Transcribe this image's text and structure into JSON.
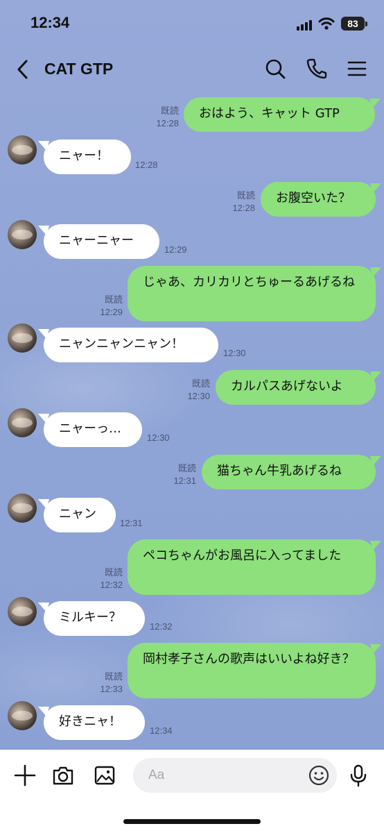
{
  "status": {
    "time": "12:34",
    "battery": "83"
  },
  "header": {
    "back_icon": "chevron-left",
    "title": "CAT GTP",
    "search_icon": "search",
    "call_icon": "phone",
    "menu_icon": "menu"
  },
  "messages": [
    {
      "side": "out",
      "read": "既読",
      "time": "12:28",
      "text": "おはよう、キャット GTP"
    },
    {
      "side": "in",
      "time": "12:28",
      "text": "ニャー！"
    },
    {
      "side": "out",
      "read": "既読",
      "time": "12:28",
      "text": "お腹空いた？"
    },
    {
      "side": "in",
      "time": "12:29",
      "text": "ニャーニャー"
    },
    {
      "side": "out",
      "read": "既読",
      "time": "12:29",
      "text": "じゃあ、カリカリとちゅーるあげるね"
    },
    {
      "side": "in",
      "time": "12:30",
      "text": "ニャンニャンニャン！"
    },
    {
      "side": "out",
      "read": "既読",
      "time": "12:30",
      "text": "カルパスあげないよ"
    },
    {
      "side": "in",
      "time": "12:30",
      "text": "ニャーっ…"
    },
    {
      "side": "out",
      "read": "既読",
      "time": "12:31",
      "text": "猫ちゃん牛乳あげるね"
    },
    {
      "side": "in",
      "time": "12:31",
      "text": "ニャン"
    },
    {
      "side": "out",
      "read": "既読",
      "time": "12:32",
      "text": "ペコちゃんがお風呂に入ってました"
    },
    {
      "side": "in",
      "time": "12:32",
      "text": "ミルキー？"
    },
    {
      "side": "out",
      "read": "既読",
      "time": "12:33",
      "text": "岡村孝子さんの歌声はいいよね好き？"
    },
    {
      "side": "in",
      "time": "12:34",
      "text": "好きニャ！"
    }
  ],
  "input": {
    "placeholder": "Aa",
    "icons": [
      "plus",
      "camera",
      "image",
      "emoji",
      "microphone"
    ]
  }
}
